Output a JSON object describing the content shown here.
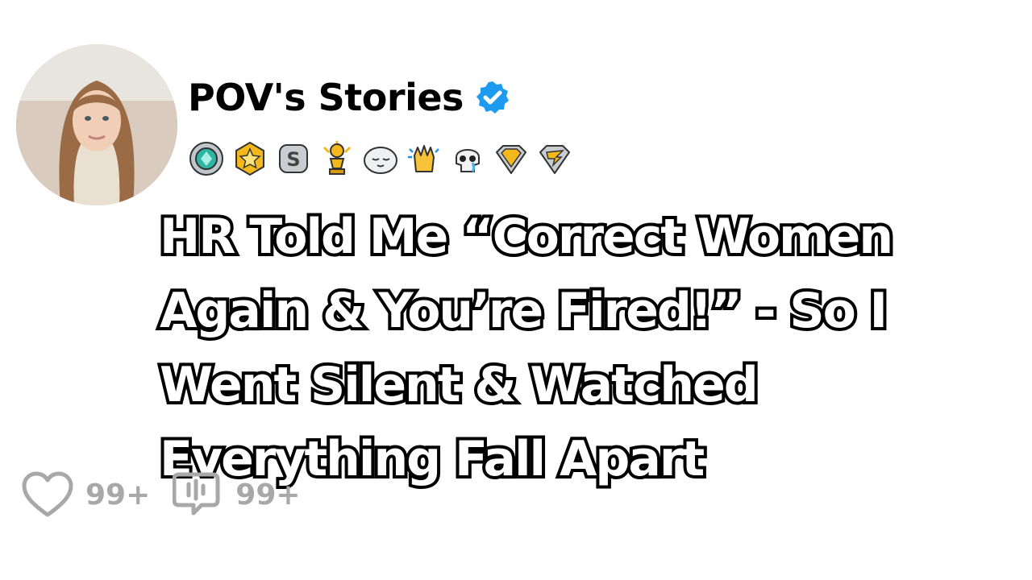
{
  "post": {
    "username": "POV's Stories",
    "title": "HR Told Me “Correct Women Again & You’re Fired!” - So I Went Silent & Watched Everything Fall Apart",
    "likes": "99+",
    "comments": "99+"
  },
  "icons": {
    "avatar": "profile-photo",
    "verified": "verified-badge-icon",
    "like": "heart-outline-icon",
    "comment": "comment-bubble-icon"
  },
  "badges": [
    "teal-gem-award",
    "gold-star-award",
    "silver-s-award",
    "gold-trophy-award",
    "sleeping-face-award",
    "clapping-hands-award",
    "crying-skull-award",
    "gold-diamond-award",
    "silver-wing-award"
  ],
  "colors": {
    "verified": "#1d9bf0",
    "stat_gray": "#a8a8a8",
    "title_fill": "#ffffff",
    "title_stroke": "#000000"
  }
}
